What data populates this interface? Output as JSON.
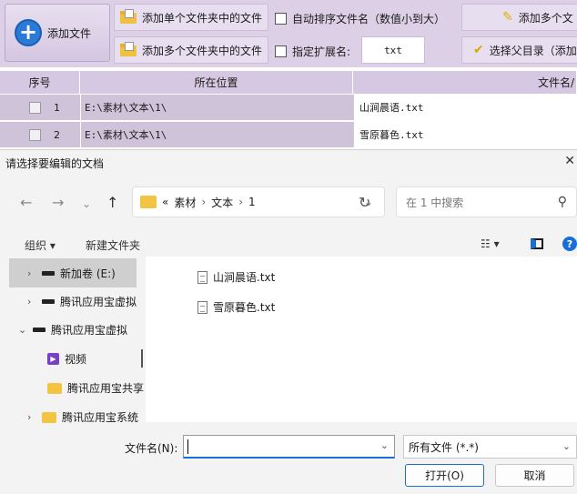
{
  "toolbar": {
    "add_file_label": "添加文件",
    "add_single_folder_label": "添加单个文件夹中的文件",
    "add_multi_folder_label": "添加多个文件夹中的文件",
    "auto_sort_label": "自动排序文件名（数值小到大）",
    "specify_ext_label": "指定扩展名:",
    "ext_value": "txt",
    "add_multi_files_label": "添加多个文",
    "choose_parent_label": "选择父目录（添加"
  },
  "table": {
    "headers": [
      "序号",
      "所在位置",
      "文件名/"
    ],
    "rows": [
      {
        "index": "1",
        "location": "E:\\素材\\文本\\1\\",
        "filename": "山涧晨语.txt"
      },
      {
        "index": "2",
        "location": "E:\\素材\\文本\\1\\",
        "filename": "雪原暮色.txt"
      }
    ]
  },
  "dialog": {
    "title": "请选择要编辑的文档",
    "close_glyph": "✕",
    "breadcrumb": [
      "«",
      "素材",
      "文本",
      "1"
    ],
    "search_placeholder": "在 1 中搜索",
    "organize_label": "组织 ▾",
    "new_folder_label": "新建文件夹",
    "sidebar": [
      {
        "label": "新加卷 (E:)",
        "icon": "drive-icon",
        "chevron": "›",
        "selected": true
      },
      {
        "label": "腾讯应用宝虚拟",
        "icon": "drive-icon",
        "chevron": "›"
      },
      {
        "label": "腾讯应用宝虚拟",
        "icon": "drive-icon",
        "chevron": "⌄"
      },
      {
        "label": "视频",
        "icon": "video-icon",
        "chevron": ""
      },
      {
        "label": "腾讯应用宝共享",
        "icon": "folder-icon",
        "chevron": ""
      },
      {
        "label": "腾讯应用宝系统",
        "icon": "folder-icon",
        "chevron": "›"
      }
    ],
    "files": [
      "山涧晨语.txt",
      "雪原暮色.txt"
    ],
    "filename_label": "文件名(N):",
    "filename_value": "",
    "filetype_value": "所有文件 (*.*)",
    "open_label": "打开(O)",
    "cancel_label": "取消"
  },
  "colors": {
    "toolbar_bg": "#dccfe6",
    "accent_blue": "#1a6fd6",
    "folder_yellow": "#f3c441"
  }
}
